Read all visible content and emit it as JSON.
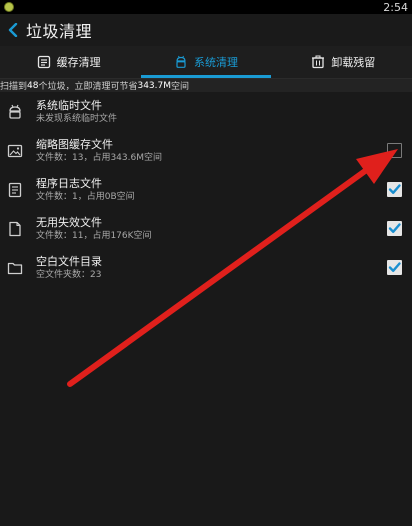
{
  "status_bar": {
    "time": "2:54"
  },
  "header": {
    "title": "垃圾清理"
  },
  "tabs": [
    {
      "label": "缓存清理",
      "icon": "document-list-icon",
      "active": false
    },
    {
      "label": "系统清理",
      "icon": "android-icon",
      "active": true
    },
    {
      "label": "卸载残留",
      "icon": "uninstall-icon",
      "active": false
    }
  ],
  "summary": {
    "prefix": "扫描到",
    "count": "48",
    "middle": "个垃圾，立即清理可节省",
    "size": "343.7M",
    "suffix": "空间"
  },
  "items": [
    {
      "title": "系统临时文件",
      "subtitle": "未发现系统临时文件",
      "icon": "android-icon",
      "checkbox": "none"
    },
    {
      "title": "缩略图缓存文件",
      "subtitle": "文件数：13，占用343.6M空间",
      "icon": "image-icon",
      "checkbox": "unchecked"
    },
    {
      "title": "程序日志文件",
      "subtitle": "文件数：1，占用0B空间",
      "icon": "log-file-icon",
      "checkbox": "checked"
    },
    {
      "title": "无用失效文件",
      "subtitle": "文件数：11，占用176K空间",
      "icon": "blank-file-icon",
      "checkbox": "checked"
    },
    {
      "title": "空白文件目录",
      "subtitle": "空文件夹数：23",
      "icon": "folder-icon",
      "checkbox": "checked"
    }
  ],
  "colors": {
    "accent": "#1a9bd4",
    "annotation_arrow": "#e0201c",
    "background": "#191919"
  }
}
